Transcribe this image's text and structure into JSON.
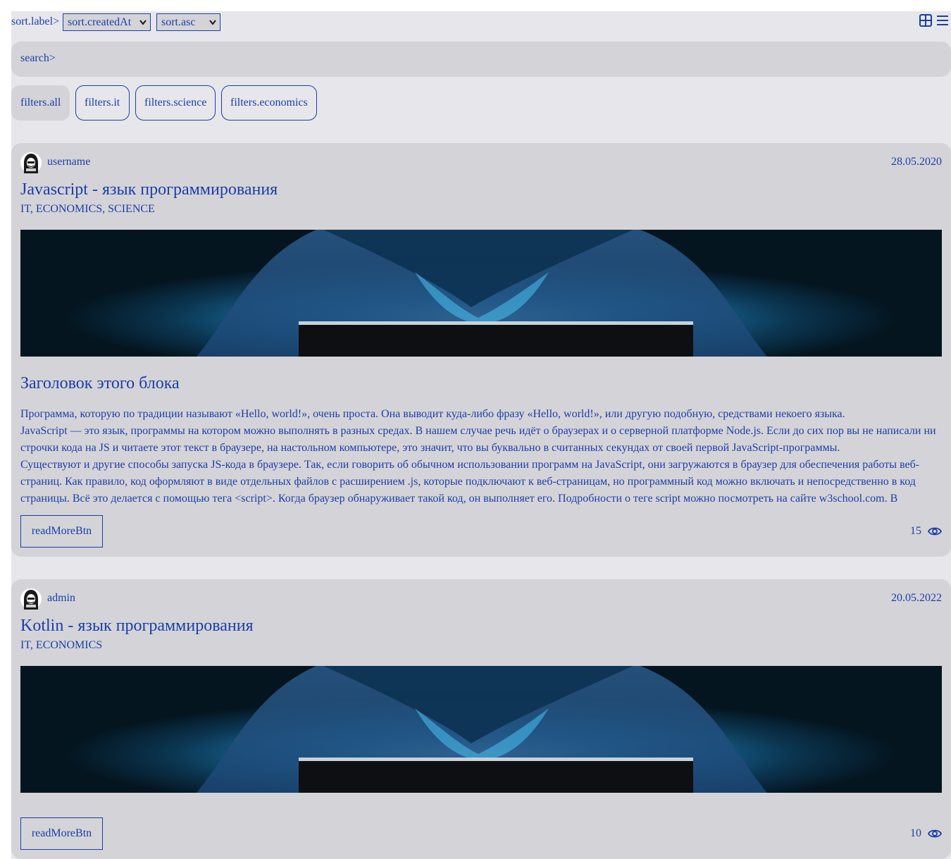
{
  "toolbar": {
    "sort_label": "sort.label>",
    "sort_field": {
      "selected": "sort.createdAt"
    },
    "sort_order": {
      "selected": "sort.asc"
    },
    "view_icons": [
      "tile-view-icon",
      "list-view-icon"
    ]
  },
  "search": {
    "placeholder": "search>"
  },
  "filters": [
    {
      "label": "filters.all",
      "active": true
    },
    {
      "label": "filters.it",
      "active": false
    },
    {
      "label": "filters.science",
      "active": false
    },
    {
      "label": "filters.economics",
      "active": false
    }
  ],
  "articles": [
    {
      "author": "username",
      "date": "28.05.2020",
      "title": "Javascript - язык программирования",
      "types": "IT, ECONOMICS, SCIENCE",
      "block_title": "Заголовок этого блока",
      "paragraphs": [
        "Программа, которую по традиции называют «Hello, world!», очень проста. Она выводит куда-либо фразу «Hello, world!», или другую подобную, средствами некоего языка.",
        "JavaScript — это язык, программы на котором можно выполнять в разных средах. В нашем случае речь идёт о браузерах и о серверной платформе Node.js. Если до сих пор вы не написали ни строчки кода на JS и читаете этот текст в браузере, на настольном компьютере, это значит, что вы буквально в считанных секундах от своей первой JavaScript-программы.",
        "Существуют и другие способы запуска JS-кода в браузере. Так, если говорить об обычном использовании программ на JavaScript, они загружаются в браузер для обеспечения работы веб-страниц. Как правило, код оформляют в виде отдельных файлов с расширением .js, которые подключают к веб-страницам, но программный код можно включать и непосредственно в код страницы. Всё это делается с помощью тега <script>. Когда браузер обнаруживает такой код, он выполняет его. Подробности о теге script можно посмотреть на сайте w3school.com. В"
      ],
      "read_more": "readMoreBtn",
      "views": "15"
    },
    {
      "author": "admin",
      "date": "20.05.2022",
      "title": "Kotlin - язык программирования",
      "types": "IT, ECONOMICS",
      "read_more": "readMoreBtn",
      "views": "10"
    }
  ],
  "colors": {
    "accent": "#1a3ea8",
    "card_bg": "#d4d4d8",
    "page_bg": "#e7e7eb"
  }
}
